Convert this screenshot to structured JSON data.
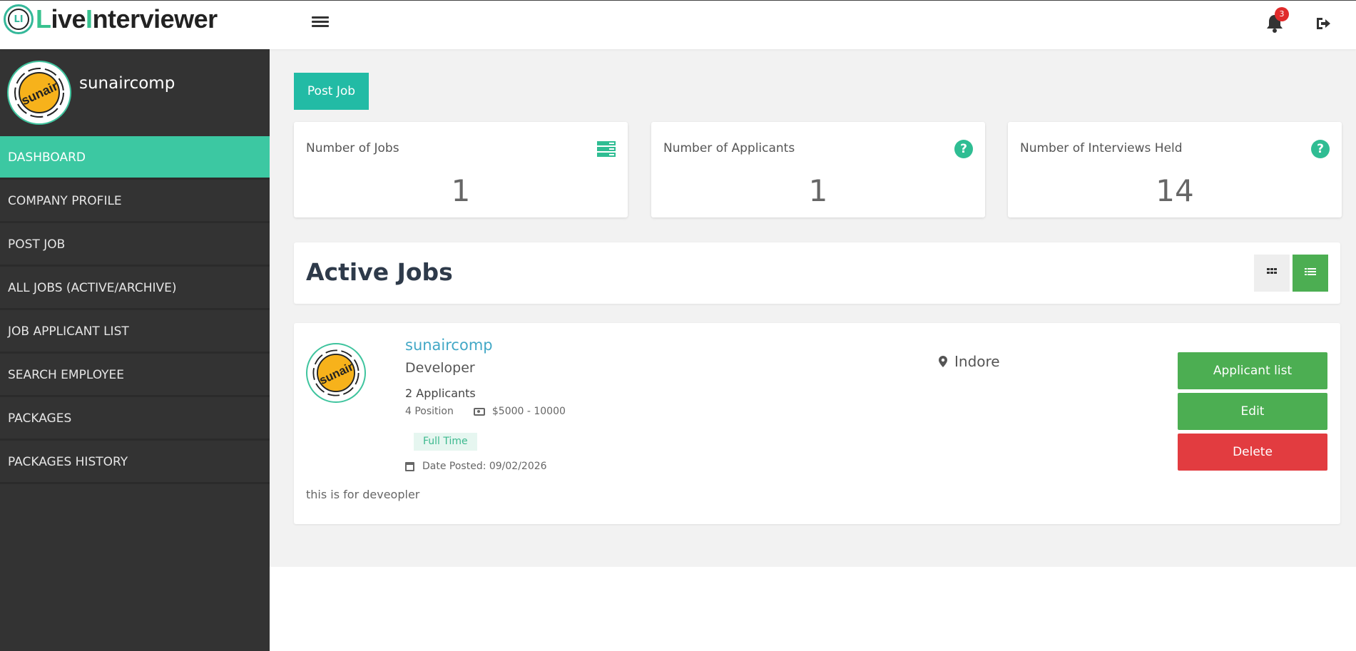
{
  "app": {
    "logo_prefix": "L",
    "logo_mid": "ive",
    "logo_i": "I",
    "logo_rest": "nterviewer",
    "logo_mark": "LI"
  },
  "topbar": {
    "menu_icon": "hamburger-icon",
    "notification_count": "3",
    "notification_icon": "bell-icon",
    "logout_icon": "sign-out-icon"
  },
  "sidebar": {
    "company_name": "sunaircomp",
    "avatar_text": "sunair",
    "items": [
      {
        "label": "DASHBOARD",
        "active": true
      },
      {
        "label": "COMPANY PROFILE",
        "active": false
      },
      {
        "label": "POST JOB",
        "active": false
      },
      {
        "label": "ALL JOBS (ACTIVE/ARCHIVE)",
        "active": false
      },
      {
        "label": "JOB APPLICANT LIST",
        "active": false
      },
      {
        "label": "SEARCH EMPLOYEE",
        "active": false
      },
      {
        "label": "PACKAGES",
        "active": false
      },
      {
        "label": "PACKAGES HISTORY",
        "active": false
      }
    ]
  },
  "main": {
    "post_job_label": "Post Job",
    "stats": [
      {
        "label": "Number of Jobs",
        "value": "1",
        "icon": "server-icon"
      },
      {
        "label": "Number of Applicants",
        "value": "1",
        "icon": "question-circle-icon"
      },
      {
        "label": "Number of Interviews Held",
        "value": "14",
        "icon": "question-circle-icon"
      }
    ],
    "active_jobs_title": "Active Jobs",
    "view_icons": [
      "grid-view-icon",
      "list-view-icon"
    ],
    "job": {
      "company": "sunaircomp",
      "logo_text": "sunair",
      "title": "Developer",
      "applicants": "2 Applicants",
      "positions": "4 Position",
      "salary": "$5000 - 10000",
      "type": "Full Time",
      "date_posted": "Date Posted: 09/02/2026",
      "description": "this is for deveopler",
      "location": "Indore",
      "buttons": {
        "applicants": "Applicant list",
        "edit": "Edit",
        "delete": "Delete"
      }
    }
  },
  "colors": {
    "accent": "#3cc8a2",
    "sidebar_bg": "#333333",
    "green_button": "#4cae52",
    "delete_button": "#e23c40",
    "link": "#43a8c6"
  }
}
